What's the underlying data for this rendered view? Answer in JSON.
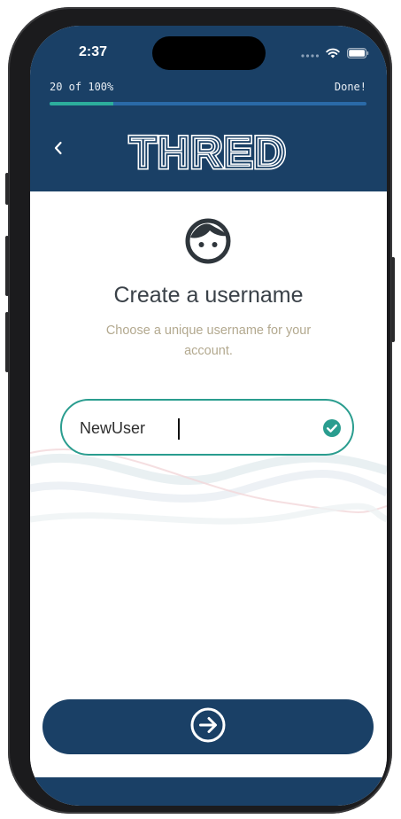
{
  "status_bar": {
    "time": "2:37"
  },
  "progress": {
    "label": "20 of 100%",
    "done_label": "Done!",
    "fraction": 0.2
  },
  "header": {
    "logo_text": "THRED",
    "back_icon": "chevron-left-icon"
  },
  "main": {
    "avatar_icon": "face-icon",
    "title": "Create a username",
    "subtitle": "Choose a unique username for your account.",
    "username": {
      "value": "NewUser",
      "valid_icon": "check-circle-icon"
    },
    "next_button_icon": "arrow-right-circle-icon"
  },
  "colors": {
    "brand_navy": "#1a4066",
    "accent_teal": "#2a9d8f",
    "progress_fill": "#2cae9c",
    "subtitle_text": "#b3a98f"
  }
}
